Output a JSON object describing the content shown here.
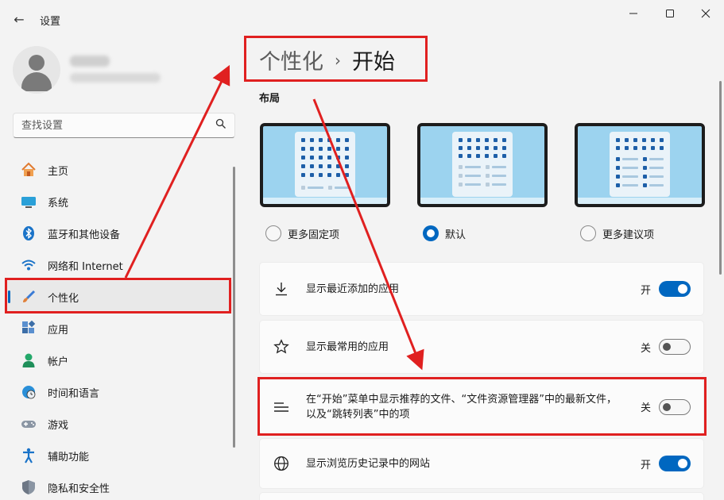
{
  "window": {
    "title": "设置",
    "back_icon": "arrow-left-icon",
    "controls": [
      "minimize-icon",
      "maximize-icon",
      "close-icon"
    ]
  },
  "search": {
    "placeholder": "查找设置",
    "value": ""
  },
  "sidebar": {
    "items": [
      {
        "label": "主页",
        "icon": "home-icon",
        "active": false
      },
      {
        "label": "系统",
        "icon": "monitor-icon",
        "active": false
      },
      {
        "label": "蓝牙和其他设备",
        "icon": "bluetooth-icon",
        "active": false
      },
      {
        "label": "网络和 Internet",
        "icon": "wifi-icon",
        "active": false
      },
      {
        "label": "个性化",
        "icon": "brush-icon",
        "active": true
      },
      {
        "label": "应用",
        "icon": "apps-icon",
        "active": false
      },
      {
        "label": "帐户",
        "icon": "account-icon",
        "active": false
      },
      {
        "label": "时间和语言",
        "icon": "clock-globe-icon",
        "active": false
      },
      {
        "label": "游戏",
        "icon": "gamepad-icon",
        "active": false
      },
      {
        "label": "辅助功能",
        "icon": "accessibility-icon",
        "active": false
      },
      {
        "label": "隐私和安全性",
        "icon": "shield-icon",
        "active": false
      }
    ]
  },
  "breadcrumb": {
    "parent": "个性化",
    "separator": "›",
    "current": "开始"
  },
  "layout_section": {
    "title": "布局",
    "options": [
      {
        "label": "更多固定项",
        "selected": false
      },
      {
        "label": "默认",
        "selected": true
      },
      {
        "label": "更多建议项",
        "selected": false
      }
    ]
  },
  "settings": [
    {
      "label": "显示最近添加的应用",
      "state": "开",
      "on": true,
      "icon": "download-icon"
    },
    {
      "label": "显示最常用的应用",
      "state": "关",
      "on": false,
      "icon": "star-icon"
    },
    {
      "label": "在“开始”菜单中显示推荐的文件、“文件资源管理器”中的最新文件，以及“跳转列表”中的项",
      "state": "关",
      "on": false,
      "icon": "list-icon"
    },
    {
      "label": "显示浏览历史记录中的网站",
      "state": "开",
      "on": true,
      "icon": "globe-icon"
    }
  ],
  "colors": {
    "accent": "#0067c0",
    "annotation": "#e02020"
  }
}
